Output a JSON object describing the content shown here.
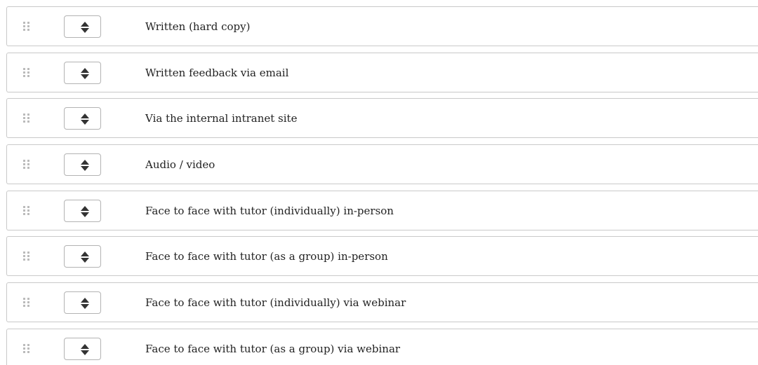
{
  "ranking": {
    "items": [
      {
        "label": "Written (hard copy)"
      },
      {
        "label": "Written feedback via email"
      },
      {
        "label": "Via the internal intranet site"
      },
      {
        "label": "Audio / video"
      },
      {
        "label": "Face to face with tutor (individually) in-person"
      },
      {
        "label": "Face to face with tutor (as a group) in-person"
      },
      {
        "label": "Face to face with tutor (individually) via webinar"
      },
      {
        "label": "Face to face with tutor (as a group) via webinar"
      }
    ],
    "icons": {
      "handle": "drag-handle-icon",
      "select": "sort-arrows-icon"
    },
    "colors": {
      "border": "#c9c9c9",
      "text": "#222222",
      "icon": "#333333",
      "handle_dots": "#bbbbbb"
    }
  }
}
